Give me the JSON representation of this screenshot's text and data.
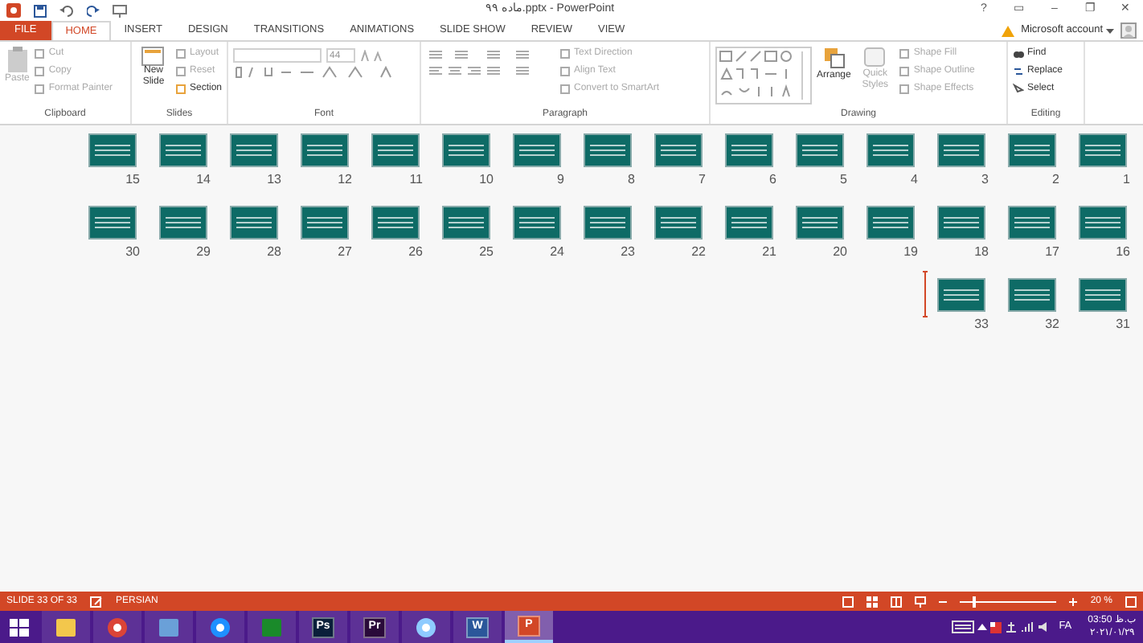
{
  "window": {
    "title": "ماده ۹۹.pptx - PowerPoint",
    "controls": [
      "?",
      "▭",
      "–",
      "❐",
      "✕"
    ]
  },
  "tabs": [
    {
      "label": "FILE",
      "kind": "file",
      "selected": false
    },
    {
      "label": "HOME",
      "kind": "tab",
      "selected": true
    },
    {
      "label": "INSERT",
      "kind": "tab",
      "selected": false
    },
    {
      "label": "DESIGN",
      "kind": "tab",
      "selected": false
    },
    {
      "label": "TRANSITIONS",
      "kind": "tab",
      "selected": false
    },
    {
      "label": "ANIMATIONS",
      "kind": "tab",
      "selected": false
    },
    {
      "label": "SLIDE SHOW",
      "kind": "tab",
      "selected": false
    },
    {
      "label": "REVIEW",
      "kind": "tab",
      "selected": false
    },
    {
      "label": "VIEW",
      "kind": "tab",
      "selected": false
    }
  ],
  "account": {
    "label": "Microsoft account"
  },
  "ribbon": {
    "clipboard": {
      "label": "Clipboard",
      "paste": {
        "label": "Paste",
        "disabled": true
      },
      "items": [
        {
          "label": "Cut",
          "disabled": true
        },
        {
          "label": "Copy",
          "disabled": true
        },
        {
          "label": "Format Painter",
          "disabled": true
        }
      ]
    },
    "slides": {
      "label": "Slides",
      "new_slide": {
        "label": "New Slide",
        "disabled": false
      },
      "items": [
        {
          "label": "Layout",
          "disabled": true
        },
        {
          "label": "Reset",
          "disabled": true
        },
        {
          "label": "Section",
          "disabled": false
        }
      ]
    },
    "font": {
      "label": "Font",
      "size": "44"
    },
    "paragraph": {
      "label": "Paragraph",
      "items": [
        {
          "label": "Text Direction",
          "disabled": true
        },
        {
          "label": "Align Text",
          "disabled": true
        },
        {
          "label": "Convert to SmartArt",
          "disabled": true
        }
      ]
    },
    "drawing": {
      "label": "Drawing",
      "arrange": "Arrange",
      "quick_styles": "Quick Styles",
      "items": [
        {
          "label": "Shape Fill",
          "disabled": true
        },
        {
          "label": "Shape Outline",
          "disabled": true
        },
        {
          "label": "Shape Effects",
          "disabled": true
        }
      ]
    },
    "editing": {
      "label": "Editing",
      "items": [
        {
          "label": "Find",
          "disabled": false
        },
        {
          "label": "Replace",
          "disabled": false
        },
        {
          "label": "Select",
          "disabled": false
        }
      ]
    }
  },
  "slide_rows": [
    [
      {
        "number": "15"
      },
      {
        "number": "14"
      },
      {
        "number": "13"
      },
      {
        "number": "12"
      },
      {
        "number": "11"
      },
      {
        "number": "10"
      },
      {
        "number": "9"
      },
      {
        "number": "8"
      },
      {
        "number": "7"
      },
      {
        "number": "6"
      },
      {
        "number": "5"
      },
      {
        "number": "4"
      },
      {
        "number": "3"
      },
      {
        "number": "2"
      },
      {
        "number": "1"
      }
    ],
    [
      {
        "number": "30"
      },
      {
        "number": "29"
      },
      {
        "number": "28"
      },
      {
        "number": "27"
      },
      {
        "number": "26"
      },
      {
        "number": "25"
      },
      {
        "number": "24"
      },
      {
        "number": "23"
      },
      {
        "number": "22"
      },
      {
        "number": "21"
      },
      {
        "number": "20"
      },
      {
        "number": "19"
      },
      {
        "number": "18"
      },
      {
        "number": "17"
      },
      {
        "number": "16"
      }
    ],
    [
      {
        "number": "33"
      },
      {
        "number": "32"
      },
      {
        "number": "31"
      }
    ]
  ],
  "status_bar": {
    "slide": "SLIDE 33 OF 33",
    "language": "PERSIAN",
    "zoom": "20 %",
    "zoom_slider": {
      "level": 0.12
    }
  },
  "taskbar": {
    "apps": [
      {
        "kind": "explorer",
        "selected": false
      },
      {
        "kind": "chrome",
        "selected": false
      },
      {
        "kind": "computer",
        "selected": false
      },
      {
        "kind": "share",
        "selected": false
      },
      {
        "kind": "calc",
        "selected": false
      },
      {
        "kind": "ps",
        "label": "Ps",
        "selected": false
      },
      {
        "kind": "pr",
        "label": "Pr",
        "selected": false
      },
      {
        "kind": "bubble",
        "selected": false
      },
      {
        "kind": "word",
        "label": "W",
        "selected": false
      },
      {
        "kind": "ppt",
        "label": "P",
        "selected": true
      }
    ],
    "lang": "FA",
    "time": "03:50 ب.ظ",
    "date": "۲۰۲۱/۰۱/۲۹"
  }
}
